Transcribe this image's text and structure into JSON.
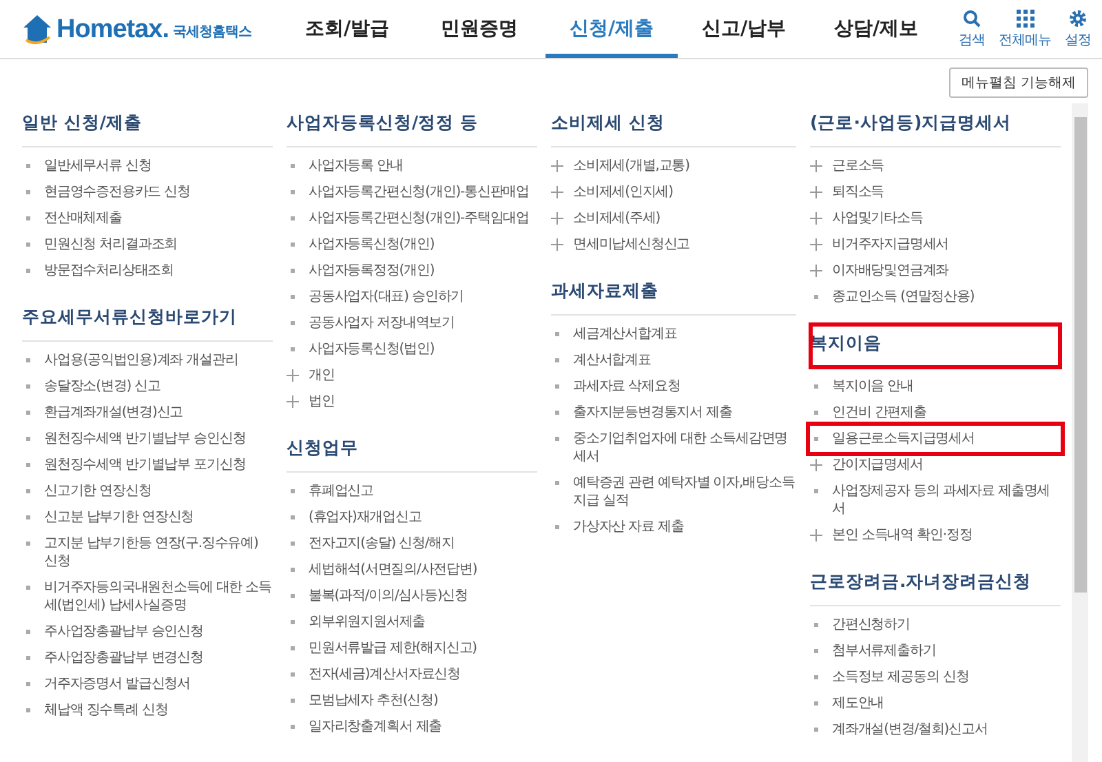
{
  "header": {
    "logo": {
      "brand": "Hometax.",
      "name": "국세청홈택스"
    },
    "nav": [
      {
        "label": "조회/발급",
        "selected": false
      },
      {
        "label": "민원증명",
        "selected": false
      },
      {
        "label": "신청/제출",
        "selected": true
      },
      {
        "label": "신고/납부",
        "selected": false
      },
      {
        "label": "상담/제보",
        "selected": false
      }
    ],
    "tools": [
      {
        "kind": "search",
        "label": "검색"
      },
      {
        "kind": "grid",
        "label": "전체메뉴"
      },
      {
        "kind": "gear",
        "label": "설정"
      }
    ]
  },
  "toggle_button": "메뉴펼침 기능해제",
  "columns": [
    {
      "sections": [
        {
          "heading": "일반 신청/제출",
          "highlighted": false,
          "items": [
            {
              "label": "일반세무서류 신청",
              "kind": "dot",
              "highlighted": false
            },
            {
              "label": "현금영수증전용카드 신청",
              "kind": "dot",
              "highlighted": false
            },
            {
              "label": "전산매체제출",
              "kind": "dot",
              "highlighted": false
            },
            {
              "label": "민원신청 처리결과조회",
              "kind": "dot",
              "highlighted": false
            },
            {
              "label": "방문접수처리상태조회",
              "kind": "dot",
              "highlighted": false
            }
          ]
        },
        {
          "heading": "주요세무서류신청바로가기",
          "highlighted": false,
          "items": [
            {
              "label": "사업용(공익법인용)계좌 개설관리",
              "kind": "dot",
              "highlighted": false
            },
            {
              "label": "송달장소(변경) 신고",
              "kind": "dot",
              "highlighted": false
            },
            {
              "label": "환급계좌개설(변경)신고",
              "kind": "dot",
              "highlighted": false
            },
            {
              "label": "원천징수세액 반기별납부 승인신청",
              "kind": "dot",
              "highlighted": false
            },
            {
              "label": "원천징수세액 반기별납부 포기신청",
              "kind": "dot",
              "highlighted": false
            },
            {
              "label": "신고기한 연장신청",
              "kind": "dot",
              "highlighted": false
            },
            {
              "label": "신고분 납부기한 연장신청",
              "kind": "dot",
              "highlighted": false
            },
            {
              "label": "고지분 납부기한등 연장(구.징수유예) 신청",
              "kind": "dot",
              "highlighted": false
            },
            {
              "label": "비거주자등의국내원천소득에 대한 소득세(법인세) 납세사실증명",
              "kind": "dot",
              "highlighted": false
            },
            {
              "label": "주사업장총괄납부 승인신청",
              "kind": "dot",
              "highlighted": false
            },
            {
              "label": "주사업장총괄납부 변경신청",
              "kind": "dot",
              "highlighted": false
            },
            {
              "label": "거주자증명서 발급신청서",
              "kind": "dot",
              "highlighted": false
            },
            {
              "label": "체납액 징수특례 신청",
              "kind": "dot",
              "highlighted": false
            }
          ]
        }
      ]
    },
    {
      "sections": [
        {
          "heading": "사업자등록신청/정정 등",
          "highlighted": false,
          "items": [
            {
              "label": "사업자등록 안내",
              "kind": "dot",
              "highlighted": false
            },
            {
              "label": "사업자등록간편신청(개인)-통신판매업",
              "kind": "dot",
              "highlighted": false
            },
            {
              "label": "사업자등록간편신청(개인)-주택임대업",
              "kind": "dot",
              "highlighted": false
            },
            {
              "label": "사업자등록신청(개인)",
              "kind": "dot",
              "highlighted": false
            },
            {
              "label": "사업자등록정정(개인)",
              "kind": "dot",
              "highlighted": false
            },
            {
              "label": "공동사업자(대표) 승인하기",
              "kind": "dot",
              "highlighted": false
            },
            {
              "label": "공동사업자 저장내역보기",
              "kind": "dot",
              "highlighted": false
            },
            {
              "label": "사업자등록신청(법인)",
              "kind": "dot",
              "highlighted": false
            },
            {
              "label": "개인",
              "kind": "plus",
              "highlighted": false
            },
            {
              "label": "법인",
              "kind": "plus",
              "highlighted": false
            }
          ]
        },
        {
          "heading": "신청업무",
          "highlighted": false,
          "items": [
            {
              "label": "휴폐업신고",
              "kind": "dot",
              "highlighted": false
            },
            {
              "label": "(휴업자)재개업신고",
              "kind": "dot",
              "highlighted": false
            },
            {
              "label": "전자고지(송달) 신청/해지",
              "kind": "dot",
              "highlighted": false
            },
            {
              "label": "세법해석(서면질의/사전답변)",
              "kind": "dot",
              "highlighted": false
            },
            {
              "label": "불복(과적/이의/심사등)신청",
              "kind": "dot",
              "highlighted": false
            },
            {
              "label": "외부위원지원서제출",
              "kind": "dot",
              "highlighted": false
            },
            {
              "label": "민원서류발급 제한(해지신고)",
              "kind": "dot",
              "highlighted": false
            },
            {
              "label": "전자(세금)계산서자료신청",
              "kind": "dot",
              "highlighted": false
            },
            {
              "label": "모범납세자 추천(신청)",
              "kind": "dot",
              "highlighted": false
            },
            {
              "label": "일자리창출계획서 제출",
              "kind": "dot",
              "highlighted": false
            }
          ]
        }
      ]
    },
    {
      "sections": [
        {
          "heading": "소비제세 신청",
          "highlighted": false,
          "items": [
            {
              "label": "소비제세(개별,교통)",
              "kind": "plus",
              "highlighted": false
            },
            {
              "label": "소비제세(인지세)",
              "kind": "plus",
              "highlighted": false
            },
            {
              "label": "소비제세(주세)",
              "kind": "plus",
              "highlighted": false
            },
            {
              "label": "면세미납세신청신고",
              "kind": "plus",
              "highlighted": false
            }
          ]
        },
        {
          "heading": "과세자료제출",
          "highlighted": false,
          "items": [
            {
              "label": "세금계산서합계표",
              "kind": "dot",
              "highlighted": false
            },
            {
              "label": "계산서합계표",
              "kind": "dot",
              "highlighted": false
            },
            {
              "label": "과세자료 삭제요청",
              "kind": "dot",
              "highlighted": false
            },
            {
              "label": "출자지분등변경통지서 제출",
              "kind": "dot",
              "highlighted": false
            },
            {
              "label": "중소기업취업자에 대한 소득세감면명세서",
              "kind": "dot",
              "highlighted": false
            },
            {
              "label": "예탁증권 관련 예탁자별 이자,배당소득 지급 실적",
              "kind": "dot",
              "highlighted": false
            },
            {
              "label": "가상자산 자료 제출",
              "kind": "dot",
              "highlighted": false
            }
          ]
        }
      ]
    },
    {
      "sections": [
        {
          "heading": "(근로·사업등)지급명세서",
          "highlighted": false,
          "items": [
            {
              "label": "근로소득",
              "kind": "plus",
              "highlighted": false
            },
            {
              "label": "퇴직소득",
              "kind": "plus",
              "highlighted": false
            },
            {
              "label": "사업및기타소득",
              "kind": "plus",
              "highlighted": false
            },
            {
              "label": "비거주자지급명세서",
              "kind": "plus",
              "highlighted": false
            },
            {
              "label": "이자배당및연금계좌",
              "kind": "plus",
              "highlighted": false
            },
            {
              "label": "종교인소득 (연말정산용)",
              "kind": "dot",
              "highlighted": false
            }
          ]
        },
        {
          "heading": "복지이음",
          "highlighted": true,
          "items": [
            {
              "label": "복지이음 안내",
              "kind": "dot",
              "highlighted": false
            },
            {
              "label": "인건비 간편제출",
              "kind": "dot",
              "highlighted": false
            },
            {
              "label": "일용근로소득지급명세서",
              "kind": "dot",
              "highlighted": true
            },
            {
              "label": "간이지급명세서",
              "kind": "plus",
              "highlighted": false
            },
            {
              "label": "사업장제공자 등의 과세자료 제출명세서",
              "kind": "dot",
              "highlighted": false
            },
            {
              "label": "본인 소득내역 확인·정정",
              "kind": "plus",
              "highlighted": false
            }
          ]
        },
        {
          "heading": "근로장려금.자녀장려금신청",
          "highlighted": false,
          "items": [
            {
              "label": "간편신청하기",
              "kind": "dot",
              "highlighted": false
            },
            {
              "label": "첨부서류제출하기",
              "kind": "dot",
              "highlighted": false
            },
            {
              "label": "소득정보 제공동의 신청",
              "kind": "dot",
              "highlighted": false
            },
            {
              "label": "제도안내",
              "kind": "dot",
              "highlighted": false
            },
            {
              "label": "계좌개설(변경/철회)신고서",
              "kind": "dot",
              "highlighted": false
            }
          ]
        }
      ]
    }
  ]
}
